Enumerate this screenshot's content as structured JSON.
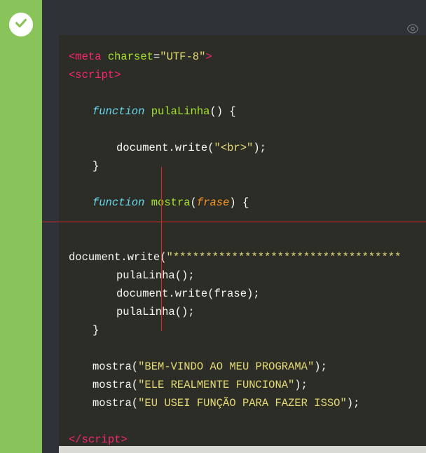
{
  "meta": {
    "tag_open": "<meta",
    "attr_name": "charset",
    "eq": "=",
    "attr_val": "\"UTF-8\"",
    "tag_close": ">"
  },
  "script_open": "<script>",
  "script_close": "</scr",
  "script_close2": "ipt>",
  "kw_function": "function",
  "fn_pulaLinha": "pulaLinha",
  "paren_empty": "() {",
  "doc_write_br_pre": "document.write(",
  "doc_write_br_str": "\"<br>\"",
  "doc_write_br_post": ");",
  "close_brace": "}",
  "fn_mostra": "mostra",
  "param_frase": "frase",
  "mostra_paren_open": "(",
  "mostra_paren_close": ") {",
  "doc_write_stars_pre": "document.write(",
  "doc_write_stars_str": "\"***********************************",
  "pulaLinha_call": "pulaLinha();",
  "doc_write_frase": "document.write(frase);",
  "mostra_call1_pre": "mostra(",
  "mostra_call1_str": "\"BEM-VINDO AO MEU PROGRAMA\"",
  "mostra_call1_post": ");",
  "mostra_call2_pre": "mostra(",
  "mostra_call2_str": "\"ELE REALMENTE FUNCIONA\"",
  "mostra_call2_post": ");",
  "mostra_call3_pre": "mostra(",
  "mostra_call3_str": "\"EU USEI FUNÇÃO PARA FAZER ISSO\"",
  "mostra_call3_post": ");"
}
